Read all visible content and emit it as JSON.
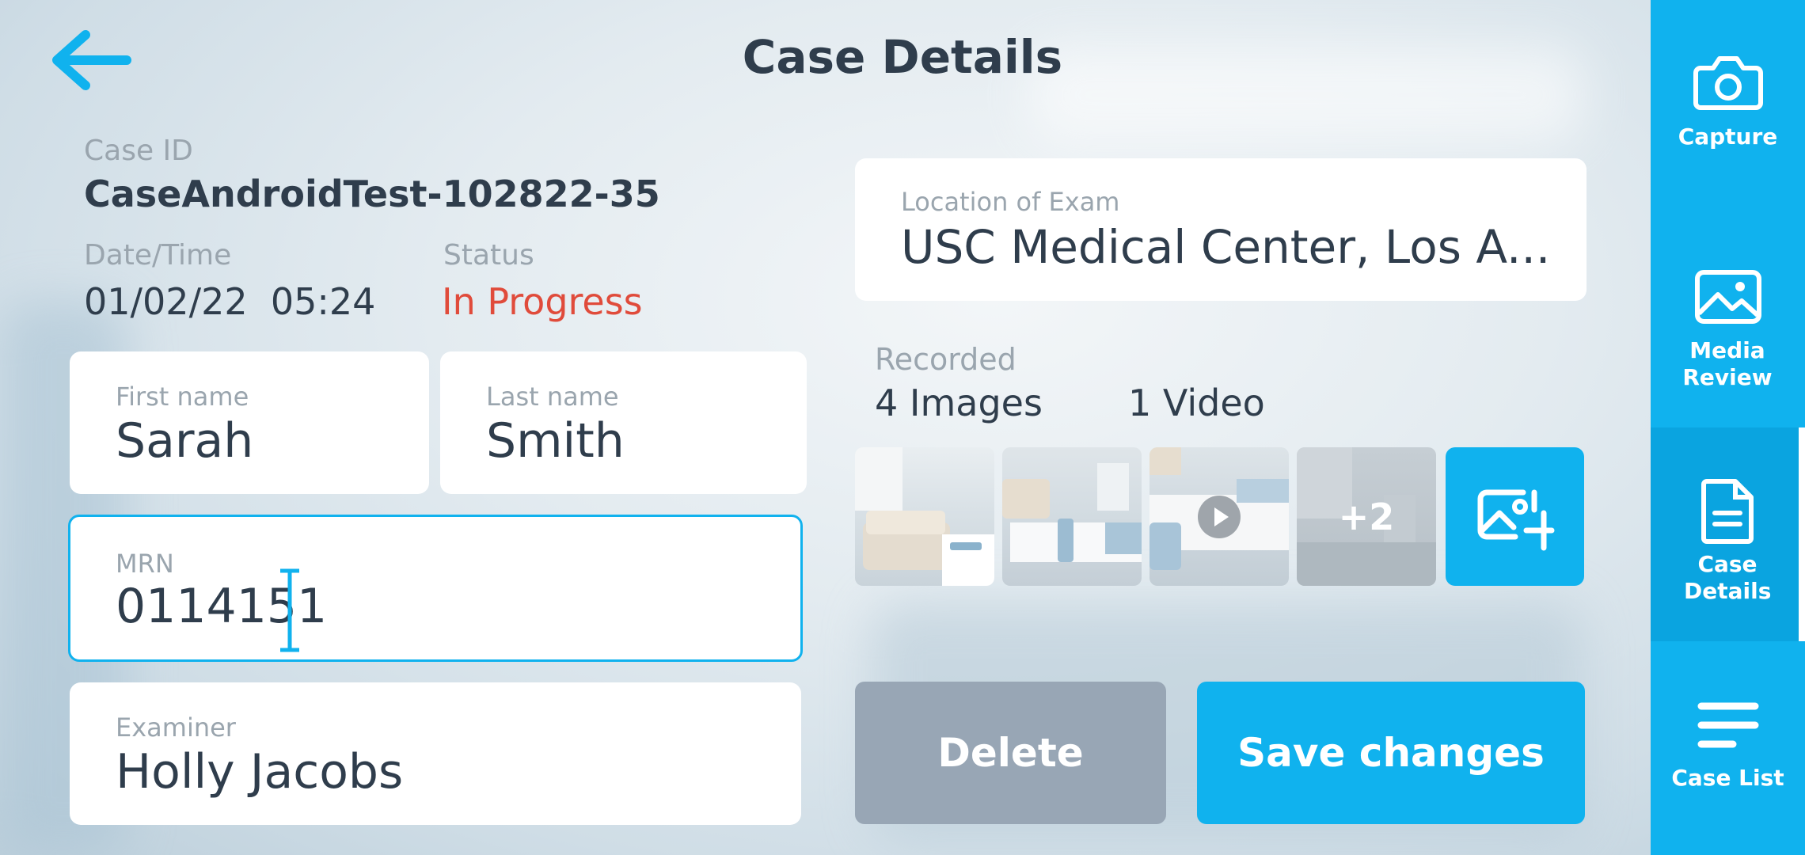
{
  "header": {
    "title": "Case Details"
  },
  "case": {
    "id_label": "Case ID",
    "id_value": "CaseAndroidTest-102822-35",
    "datetime_label": "Date/Time",
    "datetime_value": "01/02/22  05:24",
    "status_label": "Status",
    "status_value": "In Progress"
  },
  "fields": {
    "first_name": {
      "label": "First name",
      "value": "Sarah"
    },
    "last_name": {
      "label": "Last name",
      "value": "Smith"
    },
    "mrn": {
      "label": "MRN",
      "value": "0114151"
    },
    "examiner": {
      "label": "Examiner",
      "value": "Holly Jacobs"
    },
    "location": {
      "label": "Location of Exam",
      "value": "USC Medical Center, Los A..."
    }
  },
  "recorded": {
    "label": "Recorded",
    "images": "4 Images",
    "videos": "1 Video",
    "more_badge": "+2"
  },
  "actions": {
    "delete": "Delete",
    "save": "Save changes"
  },
  "sidebar": {
    "items": [
      {
        "label": "Capture",
        "icon": "camera-icon"
      },
      {
        "label": "Media Review",
        "icon": "image-icon"
      },
      {
        "label": "Case Details",
        "icon": "document-icon",
        "active": true
      },
      {
        "label": "Case List",
        "icon": "list-icon"
      }
    ]
  },
  "colors": {
    "accent": "#10b2ee",
    "status": "#e04b3b",
    "text": "#2f3d4c",
    "muted": "#9aa5ae",
    "delete": "#98a6b5"
  }
}
